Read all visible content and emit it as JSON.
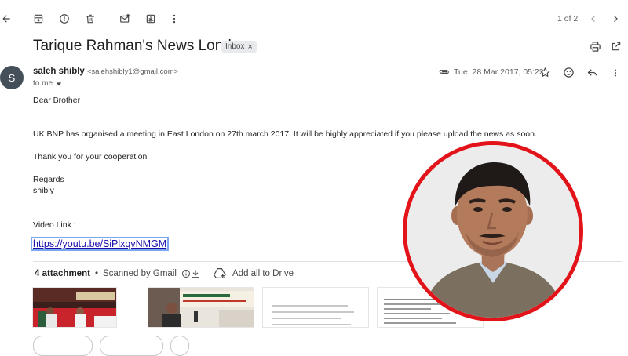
{
  "toolbar": {
    "pagination": "1 of 2"
  },
  "subject": {
    "title": "Tarique Rahman's News London",
    "label": "Inbox",
    "label_remove": "×"
  },
  "sender": {
    "avatar_letter": "S",
    "name": "saleh shibly",
    "email": "<salehshibly1@gmail.com>",
    "to_line": "to me",
    "date": "Tue, 28 Mar 2017, 05:22"
  },
  "body": {
    "greeting": "Dear Brother",
    "para1": "UK BNP has organised a meeting in East London on 27th march 2017. It will be highly appreciated if you please  upload the news as soon.",
    "para2": "Thank you for your cooperation",
    "regards": "Regards",
    "signature": "shibly",
    "video_label": "Video Link :",
    "video_link": "https://youtu.be/SiPlxqvNMGM"
  },
  "attachments": {
    "count_label": "4 attachment",
    "separator": "•",
    "scan_label": "Scanned by Gmail",
    "add_drive_label": "Add all to Drive"
  },
  "colors": {
    "accent_circle": "#e2141a",
    "link": "#1a0dab"
  }
}
